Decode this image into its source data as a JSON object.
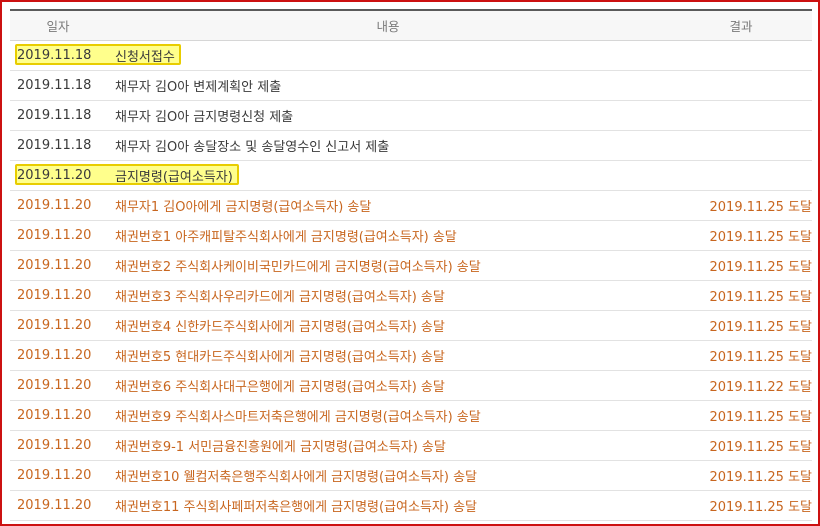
{
  "header": {
    "date": "일자",
    "content": "내용",
    "result": "결과"
  },
  "rows": [
    {
      "date": "2019.11.18",
      "content": "신청서접수",
      "result": "",
      "highlight": true,
      "orange": false
    },
    {
      "date": "2019.11.18",
      "content": "채무자 김O아 변제계획안 제출",
      "result": "",
      "highlight": false,
      "orange": false
    },
    {
      "date": "2019.11.18",
      "content": "채무자 김O아 금지명령신청 제출",
      "result": "",
      "highlight": false,
      "orange": false
    },
    {
      "date": "2019.11.18",
      "content": "채무자 김O아 송달장소 및 송달영수인 신고서 제출",
      "result": "",
      "highlight": false,
      "orange": false
    },
    {
      "date": "2019.11.20",
      "content": "금지명령(급여소득자)",
      "result": "",
      "highlight": true,
      "orange": false
    },
    {
      "date": "2019.11.20",
      "content": "채무자1 김O아에게 금지명령(급여소득자) 송달",
      "result": "2019.11.25 도달",
      "highlight": false,
      "orange": true
    },
    {
      "date": "2019.11.20",
      "content": "채권번호1 아주캐피탈주식회사에게 금지명령(급여소득자) 송달",
      "result": "2019.11.25 도달",
      "highlight": false,
      "orange": true
    },
    {
      "date": "2019.11.20",
      "content": "채권번호2 주식회사케이비국민카드에게 금지명령(급여소득자) 송달",
      "result": "2019.11.25 도달",
      "highlight": false,
      "orange": true
    },
    {
      "date": "2019.11.20",
      "content": "채권번호3 주식회사우리카드에게 금지명령(급여소득자) 송달",
      "result": "2019.11.25 도달",
      "highlight": false,
      "orange": true
    },
    {
      "date": "2019.11.20",
      "content": "채권번호4 신한카드주식회사에게 금지명령(급여소득자) 송달",
      "result": "2019.11.25 도달",
      "highlight": false,
      "orange": true
    },
    {
      "date": "2019.11.20",
      "content": "채권번호5 현대카드주식회사에게 금지명령(급여소득자) 송달",
      "result": "2019.11.25 도달",
      "highlight": false,
      "orange": true
    },
    {
      "date": "2019.11.20",
      "content": "채권번호6 주식회사대구은행에게 금지명령(급여소득자) 송달",
      "result": "2019.11.22 도달",
      "highlight": false,
      "orange": true
    },
    {
      "date": "2019.11.20",
      "content": "채권번호9 주식회사스마트저축은행에게 금지명령(급여소득자) 송달",
      "result": "2019.11.25 도달",
      "highlight": false,
      "orange": true
    },
    {
      "date": "2019.11.20",
      "content": "채권번호9-1 서민금융진흥원에게 금지명령(급여소득자) 송달",
      "result": "2019.11.25 도달",
      "highlight": false,
      "orange": true
    },
    {
      "date": "2019.11.20",
      "content": "채권번호10 웰컴저축은행주식회사에게 금지명령(급여소득자) 송달",
      "result": "2019.11.25 도달",
      "highlight": false,
      "orange": true
    },
    {
      "date": "2019.11.20",
      "content": "채권번호11 주식회사페퍼저축은행에게 금지명령(급여소득자) 송달",
      "result": "2019.11.25 도달",
      "highlight": false,
      "orange": true
    }
  ]
}
